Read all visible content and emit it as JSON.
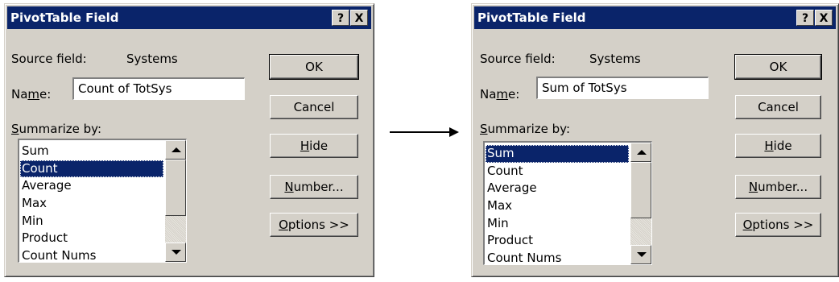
{
  "dialogs": [
    {
      "title": "PivotTable Field",
      "help_label": "?",
      "close_label": "X",
      "source_field_label": "Source field:",
      "source_field_value": "Systems",
      "name_label_pre": "Na",
      "name_label_ul": "m",
      "name_label_post": "e:",
      "name_value": "Count of TotSys",
      "summarize_ul": "S",
      "summarize_rest": "ummarize by:",
      "list_items": [
        "Sum",
        "Count",
        "Average",
        "Max",
        "Min",
        "Product",
        "Count Nums"
      ],
      "selected_item": "Count",
      "buttons": {
        "ok": "OK",
        "cancel": "Cancel",
        "hide_ul": "H",
        "hide_rest": "ide",
        "number_ul": "N",
        "number_rest": "umber...",
        "options_ul": "O",
        "options_rest": "ptions >>"
      }
    },
    {
      "title": "PivotTable Field",
      "help_label": "?",
      "close_label": "X",
      "source_field_label": "Source field:",
      "source_field_value": "Systems",
      "name_label_pre": "Na",
      "name_label_ul": "m",
      "name_label_post": "e:",
      "name_value": "Sum of TotSys",
      "summarize_ul": "S",
      "summarize_rest": "ummarize by:",
      "list_items": [
        "Sum",
        "Count",
        "Average",
        "Max",
        "Min",
        "Product",
        "Count Nums"
      ],
      "selected_item": "Sum",
      "buttons": {
        "ok": "OK",
        "cancel": "Cancel",
        "hide_ul": "H",
        "hide_rest": "ide",
        "number_ul": "N",
        "number_rest": "umber...",
        "options_ul": "O",
        "options_rest": "ptions >>"
      }
    }
  ],
  "arrow_icon": "right-arrow-icon",
  "colors": {
    "titlebar": "#0a246a",
    "dialog_face": "#d4d0c8",
    "selection": "#0a246a"
  }
}
